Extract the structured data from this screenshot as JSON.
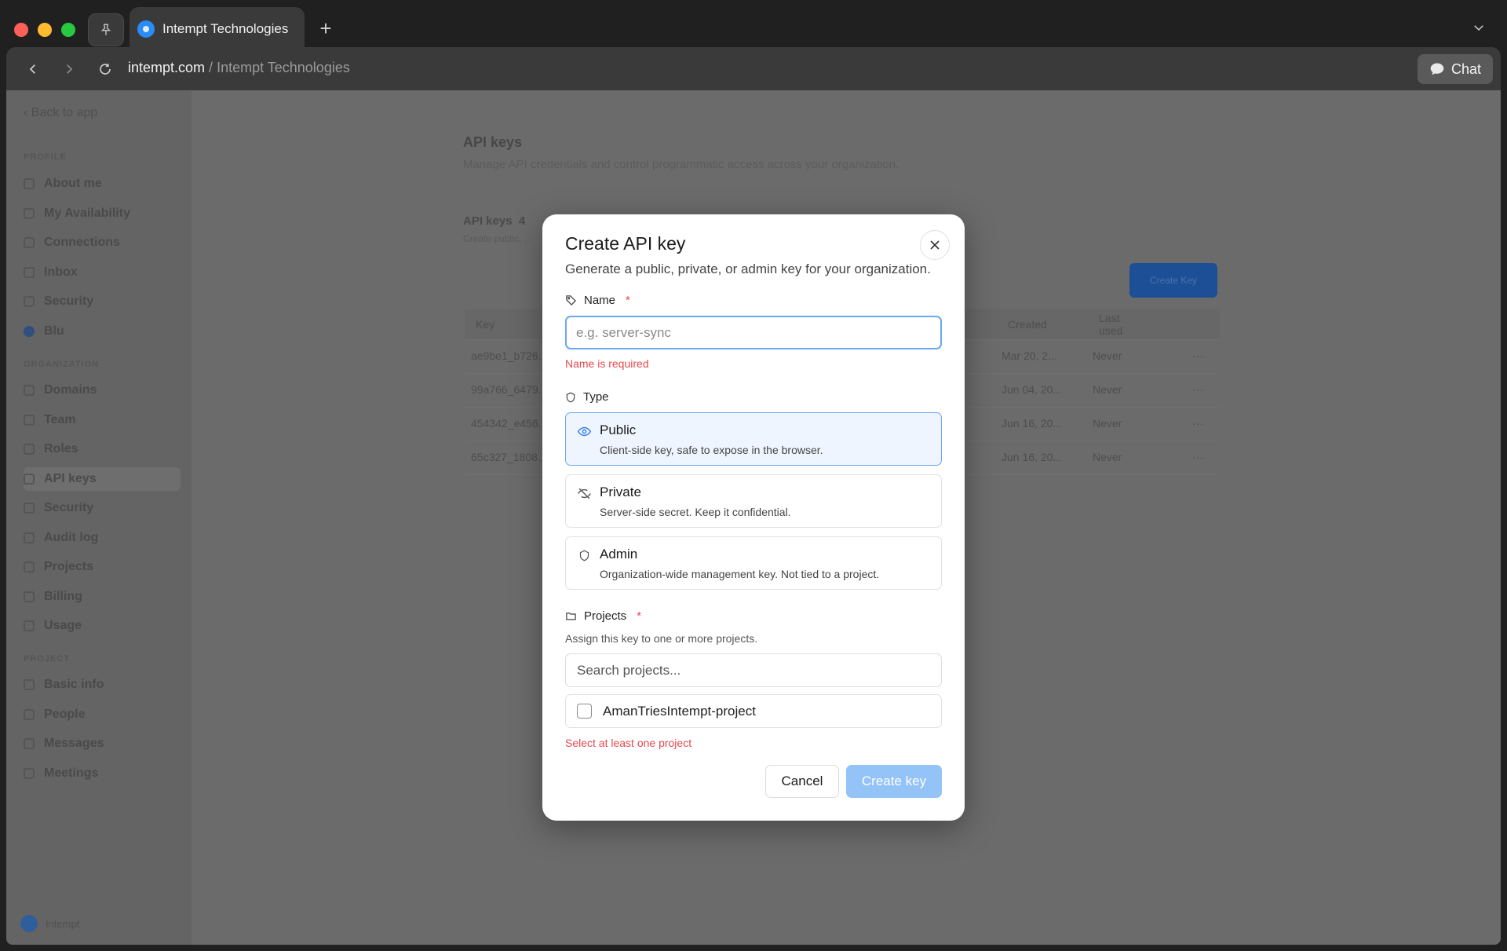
{
  "browser": {
    "tab_title": "Intempt Technologies",
    "new_tab_label": "+",
    "url_domain": "intempt.com",
    "url_separator": " / ",
    "url_title": "Intempt Technologies",
    "chat_label": "Chat"
  },
  "sidebar": {
    "back_label": "Back to app",
    "sections": {
      "profile": "PROFILE",
      "organization": "ORGANIZATION",
      "project": "PROJECT"
    },
    "profile_items": [
      "About me",
      "My Availability",
      "Connections",
      "Inbox",
      "Security",
      "Blu"
    ],
    "organization_items": [
      "Domains",
      "Team",
      "Roles",
      "API keys",
      "Security",
      "Audit log",
      "Projects",
      "Billing",
      "Usage"
    ],
    "project_items": [
      "Basic info",
      "People",
      "Messages",
      "Meetings"
    ],
    "footer_label": "Intempt"
  },
  "page": {
    "title": "API keys",
    "description": "Manage API credentials and control programmatic access across your organization.",
    "card_title": "API keys",
    "card_count": "4",
    "card_subtitle": "Create public, ...",
    "create_button": "Create Key",
    "table": {
      "headers": [
        "Key",
        "Created",
        "Last used"
      ],
      "rows": [
        {
          "key": "ae9be1_b726...",
          "created": "Mar 20, 2...",
          "last_used": "Never"
        },
        {
          "key": "99a766_6479...",
          "created": "Jun 04, 20...",
          "last_used": "Never"
        },
        {
          "key": "454342_e456...",
          "created": "Jun 16, 20...",
          "last_used": "Never"
        },
        {
          "key": "65c327_1808...",
          "created": "Jun 16, 20...",
          "last_used": "Never"
        }
      ]
    }
  },
  "modal": {
    "title": "Create API key",
    "description": "Generate a public, private, or admin key for your organization.",
    "name_label": "Name",
    "required_mark": "*",
    "name_placeholder": "e.g. server-sync",
    "name_error": "Name is required",
    "type_label": "Type",
    "types": [
      {
        "name": "Public",
        "description": "Client-side key, safe to expose in the browser.",
        "selected": true
      },
      {
        "name": "Private",
        "description": "Server-side secret. Keep it confidential.",
        "selected": false
      },
      {
        "name": "Admin",
        "description": "Organization-wide management key. Not tied to a project.",
        "selected": false
      }
    ],
    "projects_label": "Projects",
    "projects_description": "Assign this key to one or more projects.",
    "projects_search_placeholder": "Search projects...",
    "project_option": "AmanTriesIntempt-project",
    "projects_error": "Select at least one project",
    "cancel_label": "Cancel",
    "create_label": "Create key"
  },
  "colors": {
    "accent": "#6aa8f0",
    "primary_disabled": "#94c3f7",
    "error": "#e5484d",
    "selected_bg": "#eef5fe"
  }
}
